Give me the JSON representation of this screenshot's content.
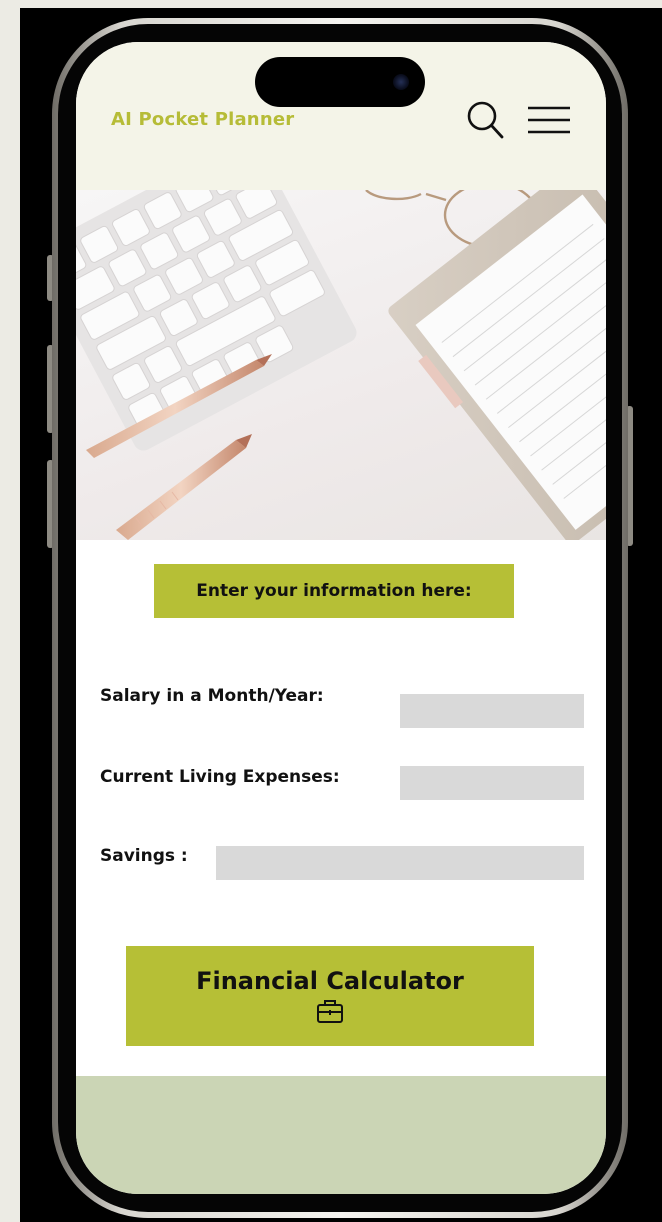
{
  "app": {
    "brand_title": "AI Pocket Planner"
  },
  "header": {
    "search_icon": "search-icon",
    "menu_icon": "hamburger-menu-icon"
  },
  "hero": {
    "image": "desk-flatlay-keyboard-pens-glasses-notepad"
  },
  "form": {
    "heading": "Enter your information here:",
    "fields": [
      {
        "label": "Salary in a Month/Year:",
        "value": "",
        "placeholder": ""
      },
      {
        "label": "Current Living Expenses:",
        "value": "",
        "placeholder": ""
      },
      {
        "label": "Savings :",
        "value": "",
        "placeholder": ""
      }
    ],
    "submit_label": "Financial Calculator",
    "submit_icon": "briefcase-icon"
  },
  "colors": {
    "accent": "#b6bf36",
    "brand_text": "#b6bc37",
    "header_bg": "#f4f4e8",
    "footer_bg": "#cbd5b5",
    "input_bg": "#d9d9d9"
  }
}
